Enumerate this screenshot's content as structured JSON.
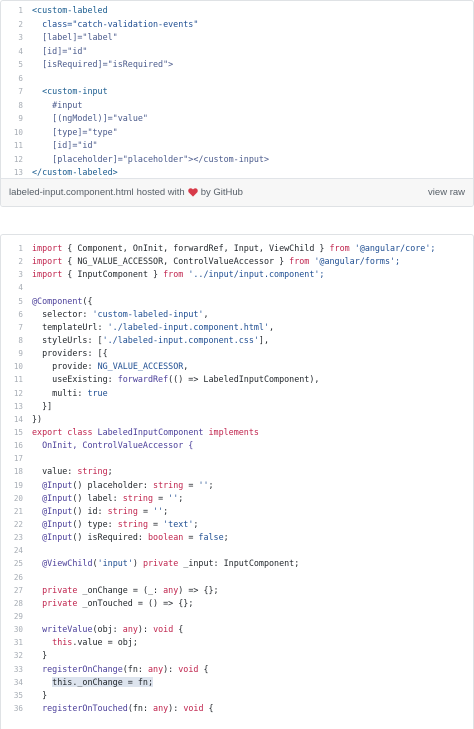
{
  "gist1": {
    "lines": [
      [
        {
          "t": "<custom-labeled",
          "c": "tag"
        }
      ],
      [
        {
          "t": "  class=\"catch-validation-events\"",
          "c": "str"
        }
      ],
      [
        {
          "t": "  [label]=\"label\"",
          "c": "attr"
        }
      ],
      [
        {
          "t": "  [id]=\"id\"",
          "c": "attr"
        }
      ],
      [
        {
          "t": "  [isRequired]=\"isRequired\">",
          "c": "attr"
        }
      ],
      [
        {
          "t": "",
          "c": ""
        }
      ],
      [
        {
          "t": "  <custom-input",
          "c": "tag"
        }
      ],
      [
        {
          "t": "    #input",
          "c": "attr"
        }
      ],
      [
        {
          "t": "    [(ngModel)]=\"value\"",
          "c": "attr"
        }
      ],
      [
        {
          "t": "    [type]=\"type\"",
          "c": "attr"
        }
      ],
      [
        {
          "t": "    [id]=\"id\"",
          "c": "attr"
        }
      ],
      [
        {
          "t": "    [placeholder]=\"placeholder\"></custom-input>",
          "c": "attr"
        }
      ],
      [
        {
          "t": "</custom-labeled>",
          "c": "tag"
        }
      ]
    ],
    "footer": {
      "filename": "labeled-input.component.html",
      "hosted_text": "hosted with",
      "by_text": "by GitHub",
      "view_raw": "view raw"
    }
  },
  "gist2": {
    "lines": [
      [
        {
          "t": "import",
          "c": "kw"
        },
        {
          "t": " { Component, OnInit, forwardRef, Input, ViewChild } ",
          "c": ""
        },
        {
          "t": "from",
          "c": "kw"
        },
        {
          "t": " '@angular/core';",
          "c": "str"
        }
      ],
      [
        {
          "t": "import",
          "c": "kw"
        },
        {
          "t": " { NG_VALUE_ACCESSOR, ControlValueAccessor } ",
          "c": ""
        },
        {
          "t": "from",
          "c": "kw"
        },
        {
          "t": " '@angular/forms';",
          "c": "str"
        }
      ],
      [
        {
          "t": "import",
          "c": "kw"
        },
        {
          "t": " { InputComponent } ",
          "c": ""
        },
        {
          "t": "from",
          "c": "kw"
        },
        {
          "t": " '../input/input.component';",
          "c": "str"
        }
      ],
      [
        {
          "t": "",
          "c": ""
        }
      ],
      [
        {
          "t": "@Component",
          "c": "fn"
        },
        {
          "t": "({",
          "c": ""
        }
      ],
      [
        {
          "t": "  selector: ",
          "c": ""
        },
        {
          "t": "'custom-labeled-input'",
          "c": "str"
        },
        {
          "t": ",",
          "c": ""
        }
      ],
      [
        {
          "t": "  templateUrl: ",
          "c": ""
        },
        {
          "t": "'./labeled-input.component.html'",
          "c": "str"
        },
        {
          "t": ",",
          "c": ""
        }
      ],
      [
        {
          "t": "  styleUrls: [",
          "c": ""
        },
        {
          "t": "'./labeled-input.component.css'",
          "c": "str"
        },
        {
          "t": "],",
          "c": ""
        }
      ],
      [
        {
          "t": "  providers: [{",
          "c": ""
        }
      ],
      [
        {
          "t": "    provide: ",
          "c": ""
        },
        {
          "t": "NG_VALUE_ACCESSOR",
          "c": "str"
        },
        {
          "t": ",",
          "c": ""
        }
      ],
      [
        {
          "t": "    useExisting: ",
          "c": ""
        },
        {
          "t": "forwardRef",
          "c": "fn"
        },
        {
          "t": "(() => LabeledInputComponent),",
          "c": ""
        }
      ],
      [
        {
          "t": "    multi: ",
          "c": ""
        },
        {
          "t": "true",
          "c": "str"
        }
      ],
      [
        {
          "t": "  }]",
          "c": ""
        }
      ],
      [
        {
          "t": "})",
          "c": ""
        }
      ],
      [
        {
          "t": "export class",
          "c": "kw"
        },
        {
          "t": " LabeledInputComponent ",
          "c": "fn"
        },
        {
          "t": "implements",
          "c": "kw"
        }
      ],
      [
        {
          "t": "  OnInit, ControlValueAccessor {",
          "c": "fn"
        }
      ],
      [
        {
          "t": "",
          "c": ""
        }
      ],
      [
        {
          "t": "  value: ",
          "c": ""
        },
        {
          "t": "string",
          "c": "kw"
        },
        {
          "t": ";",
          "c": ""
        }
      ],
      [
        {
          "t": "  @Input",
          "c": "fn"
        },
        {
          "t": "() placeholder: ",
          "c": ""
        },
        {
          "t": "string",
          "c": "kw"
        },
        {
          "t": " = ",
          "c": ""
        },
        {
          "t": "''",
          "c": "str"
        },
        {
          "t": ";",
          "c": ""
        }
      ],
      [
        {
          "t": "  @Input",
          "c": "fn"
        },
        {
          "t": "() label: ",
          "c": ""
        },
        {
          "t": "string",
          "c": "kw"
        },
        {
          "t": " = ",
          "c": ""
        },
        {
          "t": "''",
          "c": "str"
        },
        {
          "t": ";",
          "c": ""
        }
      ],
      [
        {
          "t": "  @Input",
          "c": "fn"
        },
        {
          "t": "() id: ",
          "c": ""
        },
        {
          "t": "string",
          "c": "kw"
        },
        {
          "t": " = ",
          "c": ""
        },
        {
          "t": "''",
          "c": "str"
        },
        {
          "t": ";",
          "c": ""
        }
      ],
      [
        {
          "t": "  @Input",
          "c": "fn"
        },
        {
          "t": "() type: ",
          "c": ""
        },
        {
          "t": "string",
          "c": "kw"
        },
        {
          "t": " = ",
          "c": ""
        },
        {
          "t": "'text'",
          "c": "str"
        },
        {
          "t": ";",
          "c": ""
        }
      ],
      [
        {
          "t": "  @Input",
          "c": "fn"
        },
        {
          "t": "() isRequired: ",
          "c": ""
        },
        {
          "t": "boolean",
          "c": "kw"
        },
        {
          "t": " = ",
          "c": ""
        },
        {
          "t": "false",
          "c": "str"
        },
        {
          "t": ";",
          "c": ""
        }
      ],
      [
        {
          "t": "",
          "c": ""
        }
      ],
      [
        {
          "t": "  @ViewChild",
          "c": "fn"
        },
        {
          "t": "(",
          "c": ""
        },
        {
          "t": "'input'",
          "c": "str"
        },
        {
          "t": ") ",
          "c": ""
        },
        {
          "t": "private",
          "c": "kw"
        },
        {
          "t": " _input: InputComponent;",
          "c": ""
        }
      ],
      [
        {
          "t": "",
          "c": ""
        }
      ],
      [
        {
          "t": "  private",
          "c": "kw"
        },
        {
          "t": " _onChange = (_: ",
          "c": ""
        },
        {
          "t": "any",
          "c": "kw"
        },
        {
          "t": ") => {};",
          "c": ""
        }
      ],
      [
        {
          "t": "  private",
          "c": "kw"
        },
        {
          "t": " _onTouched = () => {};",
          "c": ""
        }
      ],
      [
        {
          "t": "",
          "c": ""
        }
      ],
      [
        {
          "t": "  writeValue",
          "c": "fn"
        },
        {
          "t": "(obj: ",
          "c": ""
        },
        {
          "t": "any",
          "c": "kw"
        },
        {
          "t": "): ",
          "c": ""
        },
        {
          "t": "void",
          "c": "kw"
        },
        {
          "t": " {",
          "c": ""
        }
      ],
      [
        {
          "t": "    this",
          "c": "kw"
        },
        {
          "t": ".value = obj;",
          "c": ""
        }
      ],
      [
        {
          "t": "  }",
          "c": ""
        }
      ],
      [
        {
          "t": "  registerOnChange",
          "c": "fn"
        },
        {
          "t": "(fn: ",
          "c": ""
        },
        {
          "t": "any",
          "c": "kw"
        },
        {
          "t": "): ",
          "c": ""
        },
        {
          "t": "void",
          "c": "kw"
        },
        {
          "t": " {",
          "c": ""
        }
      ],
      [
        {
          "t": "    ",
          "c": ""
        },
        {
          "t": "this._onChange = fn;",
          "c": "hl"
        }
      ],
      [
        {
          "t": "  }",
          "c": ""
        }
      ],
      [
        {
          "t": "  registerOnTouched",
          "c": "fn"
        },
        {
          "t": "(fn: ",
          "c": ""
        },
        {
          "t": "any",
          "c": "kw"
        },
        {
          "t": "): ",
          "c": ""
        },
        {
          "t": "void",
          "c": "kw"
        },
        {
          "t": " {",
          "c": ""
        }
      ]
    ]
  },
  "colors": {
    "heart": "#d73a49",
    "line_numbers": "#a6acb4",
    "footer_bg": "#f7f7f7"
  }
}
